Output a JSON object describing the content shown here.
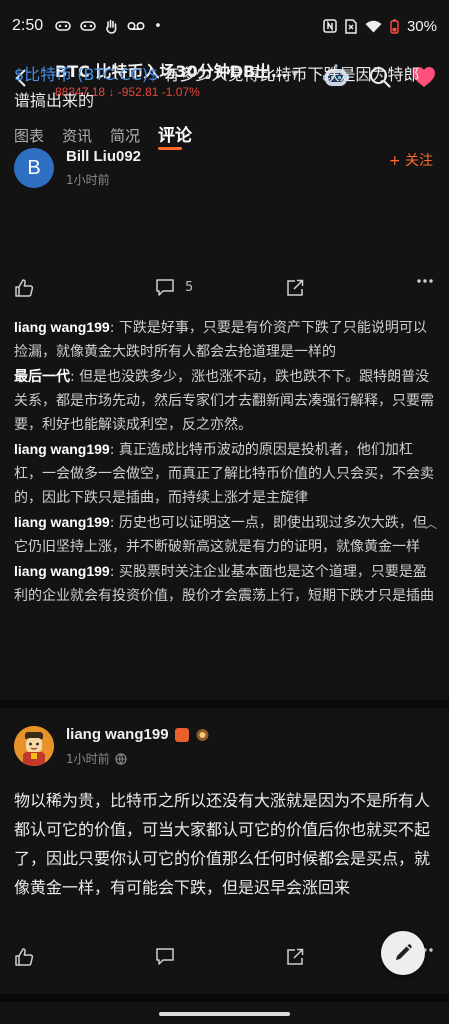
{
  "status_bar": {
    "time": "2:50",
    "battery": "30%"
  },
  "header": {
    "title": "BTC  比特币入场30分钟DB出…",
    "price": "88347.18",
    "change": "-952.81",
    "change_pct": "-1.07%",
    "price_color": "#e8453c"
  },
  "tabs": [
    {
      "label": "图表"
    },
    {
      "label": "资讯"
    },
    {
      "label": "简况"
    },
    {
      "label": "评论",
      "active": true
    }
  ],
  "post1": {
    "avatar_letter": "B",
    "author": "Bill Liu092",
    "time": "1小时前",
    "follow_label": "+ 关注",
    "ticker": "$比特币 (BTC.CC)$",
    "text": " 有多少人觉得比特币下跌是因为特郎谱搞出来的",
    "comment_count": "5",
    "replies": [
      {
        "name": "liang wang199",
        "text": ": 下跌是好事，只要是有价资产下跌了只能说明可以捡漏，就像黄金大跌时所有人都会去抢道理是一样的"
      },
      {
        "name": "最后一代",
        "text": ": 但是也没跌多少，涨也涨不动，跌也跌不下。跟特朗普没关系，都是市场先动，然后专家们才去翻新闻去凑强行解释，只要需要，利好也能解读成利空，反之亦然。"
      },
      {
        "name": "liang wang199",
        "text": ": 真正造成比特币波动的原因是投机者，他们加杠杠，一会做多一会做空，而真正了解比特币价值的人只会买，不会卖的，因此下跌只是插曲，而持续上涨才是主旋律"
      },
      {
        "name": "liang wang199",
        "text": ": 历史也可以证明这一点，即使出现过多次大跌，但它仍旧坚持上涨，并不断破新高这就是有力的证明，就像黄金一样"
      },
      {
        "name": "liang wang199",
        "text": ": 买股票时关注企业基本面也是这个道理，只要是盈利的企业就会有投资价值，股价才会震荡上行，短期下跌才只是插曲"
      }
    ]
  },
  "post2": {
    "author": "liang wang199",
    "time": "1小时前",
    "text": "物以稀为贵，比特币之所以还没有大涨就是因为不是所有人都认可它的价值，可当大家都认可它的价值后你也就买不起了，因此只要你认可它的价值那么任何时候都会是买点，就像黄金一样，有可能会下跌，但是迟早会涨回来"
  },
  "colors": {
    "accent": "#ff6a2b",
    "ticker": "#4a8fe8",
    "heart": "#ff4f7b"
  }
}
